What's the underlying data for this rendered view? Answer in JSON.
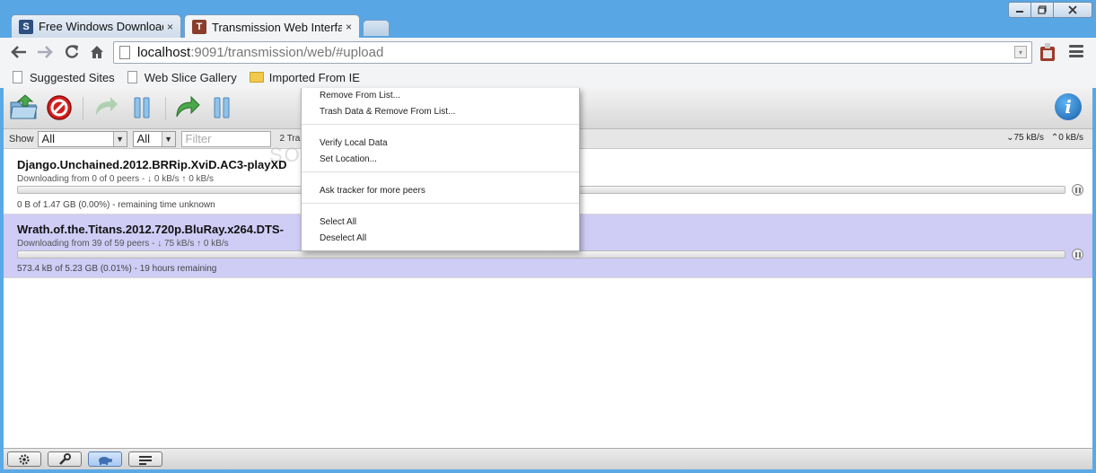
{
  "browser": {
    "tabs": [
      {
        "favicon": "S",
        "label": "Free Windows Downloads",
        "active": false
      },
      {
        "favicon": "T",
        "label": "Transmission Web Interfac",
        "active": true
      }
    ],
    "close_glyph": "×",
    "url_host": "localhost",
    "url_path": ":9091/transmission/web/#upload",
    "bookmarks": [
      "Suggested Sites",
      "Web Slice Gallery",
      "Imported From IE"
    ]
  },
  "filter": {
    "show_label": "Show",
    "state_value": "All",
    "tracker_value": "All",
    "filter_placeholder": "Filter",
    "torrent_count": "2 Tra",
    "down_speed": "⌄75 kB/s",
    "up_speed": "⌃0 kB/s"
  },
  "torrents": [
    {
      "name": "Django.Unchained.2012.BRRip.XviD.AC3-playXD",
      "peers": "Downloading from 0 of 0 peers - ↓ 0 kB/s ↑ 0 kB/s",
      "status": "0 B of 1.47 GB (0.00%) - remaining time unknown",
      "progress": 0
    },
    {
      "name": "Wrath.of.the.Titans.2012.720p.BluRay.x264.DTS-",
      "peers": "Downloading from 39 of 59 peers - ↓ 75 kB/s ↑ 0 kB/s",
      "status": "573.4 kB of 5.23 GB (0.01%) - 19 hours remaining",
      "progress": 0.0001
    }
  ],
  "context_menu": {
    "remove": "Remove From List...",
    "trash": "Trash Data & Remove From List...",
    "verify": "Verify Local Data",
    "location": "Set Location...",
    "ask_tracker": "Ask tracker for more peers",
    "select_all": "Select All",
    "deselect_all": "Deselect All"
  },
  "watermark": "SOFTPEDIA",
  "colors": {
    "selected_row": "#cfccf6",
    "chrome_frame": "#58a6e4"
  }
}
